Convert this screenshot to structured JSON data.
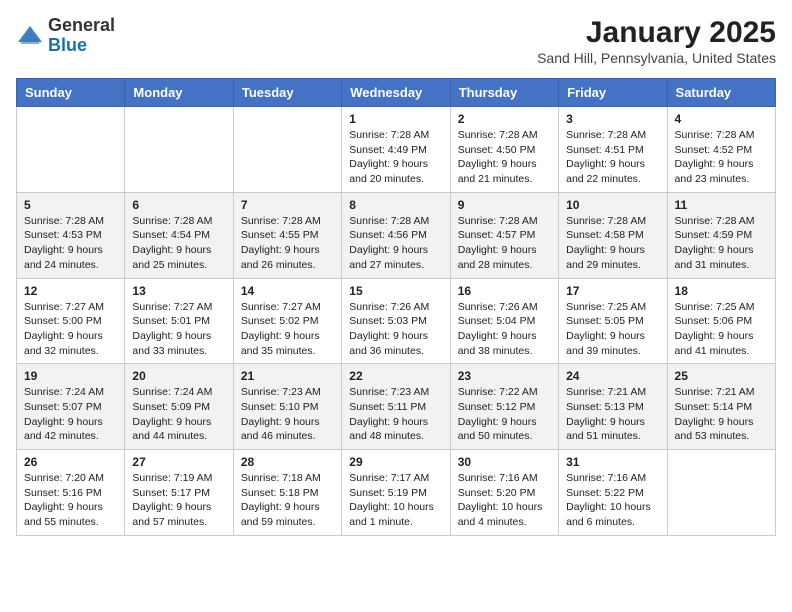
{
  "header": {
    "logo_general": "General",
    "logo_blue": "Blue",
    "title": "January 2025",
    "subtitle": "Sand Hill, Pennsylvania, United States"
  },
  "days_of_week": [
    "Sunday",
    "Monday",
    "Tuesday",
    "Wednesday",
    "Thursday",
    "Friday",
    "Saturday"
  ],
  "weeks": [
    [
      {
        "day": "",
        "info": ""
      },
      {
        "day": "",
        "info": ""
      },
      {
        "day": "",
        "info": ""
      },
      {
        "day": "1",
        "info": "Sunrise: 7:28 AM\nSunset: 4:49 PM\nDaylight: 9 hours\nand 20 minutes."
      },
      {
        "day": "2",
        "info": "Sunrise: 7:28 AM\nSunset: 4:50 PM\nDaylight: 9 hours\nand 21 minutes."
      },
      {
        "day": "3",
        "info": "Sunrise: 7:28 AM\nSunset: 4:51 PM\nDaylight: 9 hours\nand 22 minutes."
      },
      {
        "day": "4",
        "info": "Sunrise: 7:28 AM\nSunset: 4:52 PM\nDaylight: 9 hours\nand 23 minutes."
      }
    ],
    [
      {
        "day": "5",
        "info": "Sunrise: 7:28 AM\nSunset: 4:53 PM\nDaylight: 9 hours\nand 24 minutes."
      },
      {
        "day": "6",
        "info": "Sunrise: 7:28 AM\nSunset: 4:54 PM\nDaylight: 9 hours\nand 25 minutes."
      },
      {
        "day": "7",
        "info": "Sunrise: 7:28 AM\nSunset: 4:55 PM\nDaylight: 9 hours\nand 26 minutes."
      },
      {
        "day": "8",
        "info": "Sunrise: 7:28 AM\nSunset: 4:56 PM\nDaylight: 9 hours\nand 27 minutes."
      },
      {
        "day": "9",
        "info": "Sunrise: 7:28 AM\nSunset: 4:57 PM\nDaylight: 9 hours\nand 28 minutes."
      },
      {
        "day": "10",
        "info": "Sunrise: 7:28 AM\nSunset: 4:58 PM\nDaylight: 9 hours\nand 29 minutes."
      },
      {
        "day": "11",
        "info": "Sunrise: 7:28 AM\nSunset: 4:59 PM\nDaylight: 9 hours\nand 31 minutes."
      }
    ],
    [
      {
        "day": "12",
        "info": "Sunrise: 7:27 AM\nSunset: 5:00 PM\nDaylight: 9 hours\nand 32 minutes."
      },
      {
        "day": "13",
        "info": "Sunrise: 7:27 AM\nSunset: 5:01 PM\nDaylight: 9 hours\nand 33 minutes."
      },
      {
        "day": "14",
        "info": "Sunrise: 7:27 AM\nSunset: 5:02 PM\nDaylight: 9 hours\nand 35 minutes."
      },
      {
        "day": "15",
        "info": "Sunrise: 7:26 AM\nSunset: 5:03 PM\nDaylight: 9 hours\nand 36 minutes."
      },
      {
        "day": "16",
        "info": "Sunrise: 7:26 AM\nSunset: 5:04 PM\nDaylight: 9 hours\nand 38 minutes."
      },
      {
        "day": "17",
        "info": "Sunrise: 7:25 AM\nSunset: 5:05 PM\nDaylight: 9 hours\nand 39 minutes."
      },
      {
        "day": "18",
        "info": "Sunrise: 7:25 AM\nSunset: 5:06 PM\nDaylight: 9 hours\nand 41 minutes."
      }
    ],
    [
      {
        "day": "19",
        "info": "Sunrise: 7:24 AM\nSunset: 5:07 PM\nDaylight: 9 hours\nand 42 minutes."
      },
      {
        "day": "20",
        "info": "Sunrise: 7:24 AM\nSunset: 5:09 PM\nDaylight: 9 hours\nand 44 minutes."
      },
      {
        "day": "21",
        "info": "Sunrise: 7:23 AM\nSunset: 5:10 PM\nDaylight: 9 hours\nand 46 minutes."
      },
      {
        "day": "22",
        "info": "Sunrise: 7:23 AM\nSunset: 5:11 PM\nDaylight: 9 hours\nand 48 minutes."
      },
      {
        "day": "23",
        "info": "Sunrise: 7:22 AM\nSunset: 5:12 PM\nDaylight: 9 hours\nand 50 minutes."
      },
      {
        "day": "24",
        "info": "Sunrise: 7:21 AM\nSunset: 5:13 PM\nDaylight: 9 hours\nand 51 minutes."
      },
      {
        "day": "25",
        "info": "Sunrise: 7:21 AM\nSunset: 5:14 PM\nDaylight: 9 hours\nand 53 minutes."
      }
    ],
    [
      {
        "day": "26",
        "info": "Sunrise: 7:20 AM\nSunset: 5:16 PM\nDaylight: 9 hours\nand 55 minutes."
      },
      {
        "day": "27",
        "info": "Sunrise: 7:19 AM\nSunset: 5:17 PM\nDaylight: 9 hours\nand 57 minutes."
      },
      {
        "day": "28",
        "info": "Sunrise: 7:18 AM\nSunset: 5:18 PM\nDaylight: 9 hours\nand 59 minutes."
      },
      {
        "day": "29",
        "info": "Sunrise: 7:17 AM\nSunset: 5:19 PM\nDaylight: 10 hours\nand 1 minute."
      },
      {
        "day": "30",
        "info": "Sunrise: 7:16 AM\nSunset: 5:20 PM\nDaylight: 10 hours\nand 4 minutes."
      },
      {
        "day": "31",
        "info": "Sunrise: 7:16 AM\nSunset: 5:22 PM\nDaylight: 10 hours\nand 6 minutes."
      },
      {
        "day": "",
        "info": ""
      }
    ]
  ]
}
